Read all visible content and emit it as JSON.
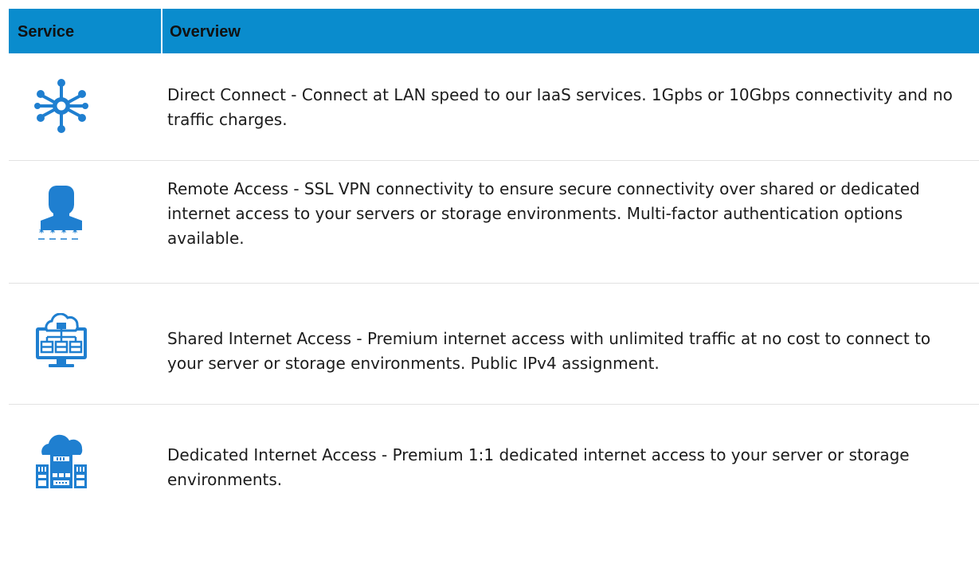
{
  "header": {
    "service_label": "Service",
    "overview_label": "Overview"
  },
  "colors": {
    "header_bg": "#0a8ccd",
    "icon_blue": "#1f7fd0",
    "divider": "#e2e2e2"
  },
  "rows": [
    {
      "icon": "network-hub-icon",
      "text": "Direct Connect - Connect at LAN speed to our IaaS services. 1Gpbs or 10Gbps connectivity and no traffic charges."
    },
    {
      "icon": "user-password-icon",
      "text": "Remote Access - SSL VPN connectivity to ensure secure connectivity over shared or dedicated internet access to your servers or storage environments. Multi-factor authentication options available."
    },
    {
      "icon": "cloud-monitor-network-icon",
      "text": "Shared Internet Access - Premium internet access with unlimited traffic at no cost to connect to your server or storage environments. Public IPv4 assignment."
    },
    {
      "icon": "cloud-datacenter-icon",
      "text": "Dedicated Internet Access - Premium 1:1 dedicated internet access to your server or storage environments."
    }
  ]
}
